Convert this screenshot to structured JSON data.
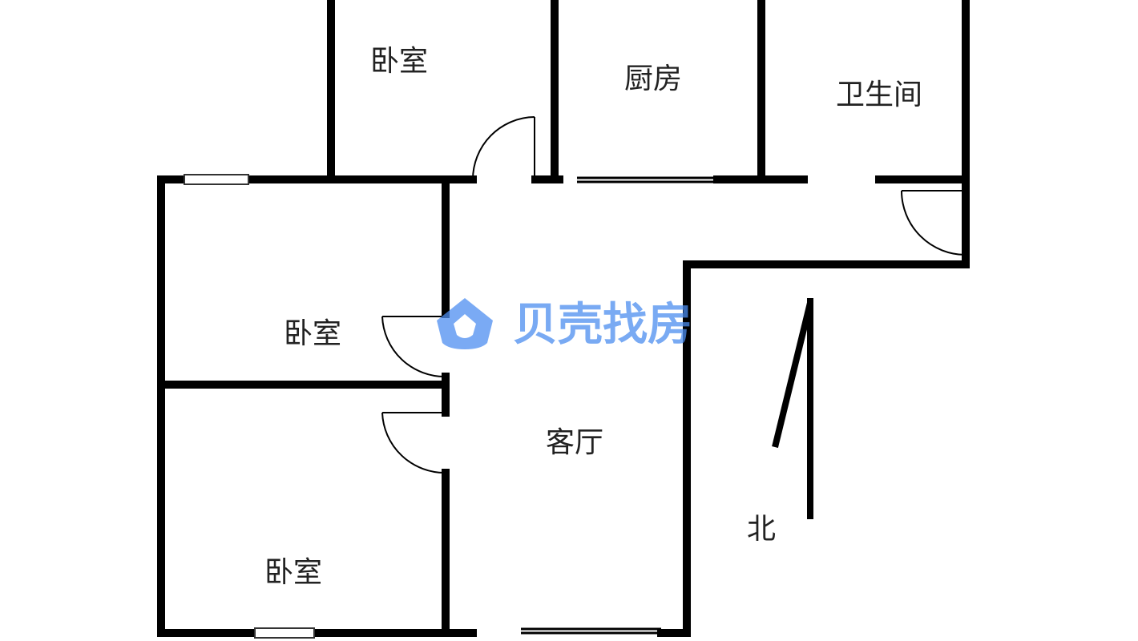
{
  "rooms": {
    "bedroom_top": "卧室",
    "kitchen": "厨房",
    "bathroom": "卫生间",
    "bedroom_middle": "卧室",
    "bedroom_bottom": "卧室",
    "living_room": "客厅"
  },
  "compass": {
    "label": "北"
  },
  "watermark": {
    "text": "贝壳找房",
    "color": "#4d8ef0"
  },
  "colors": {
    "wall": "#000000",
    "background": "#ffffff"
  }
}
